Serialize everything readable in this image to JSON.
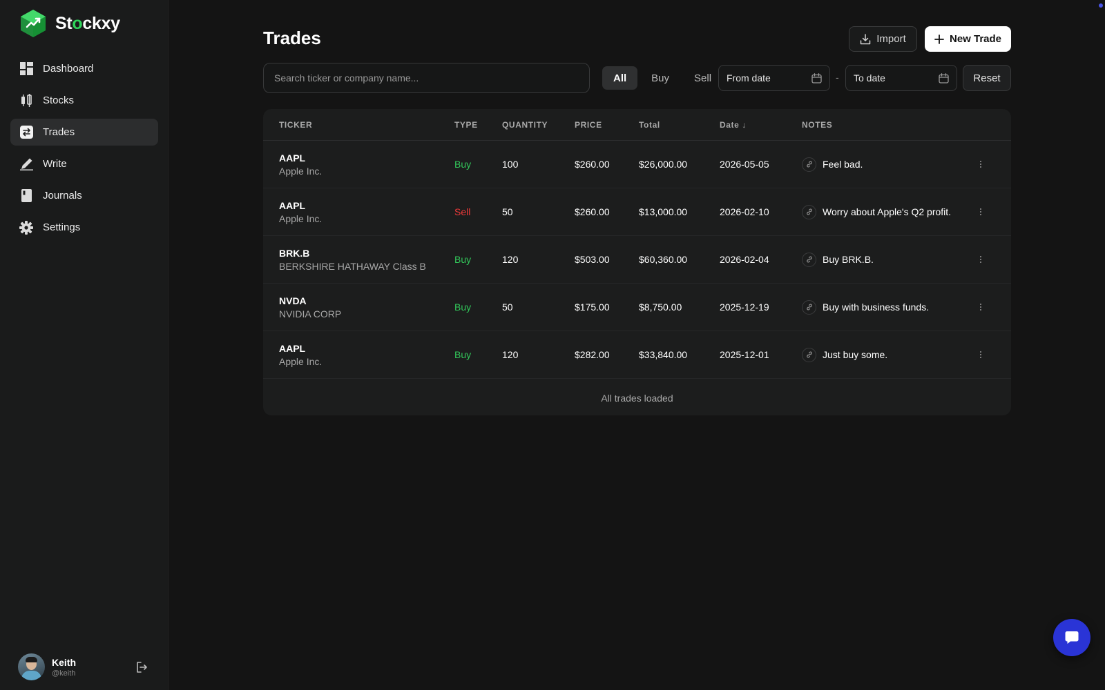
{
  "brand": {
    "name_pre": "St",
    "name_accent": "o",
    "name_post": "ckxy"
  },
  "sidebar": {
    "items": [
      {
        "label": "Dashboard",
        "icon": "dashboard-icon",
        "active": false
      },
      {
        "label": "Stocks",
        "icon": "stocks-icon",
        "active": false
      },
      {
        "label": "Trades",
        "icon": "trades-icon",
        "active": true
      },
      {
        "label": "Write",
        "icon": "pencil-icon",
        "active": false
      },
      {
        "label": "Journals",
        "icon": "book-icon",
        "active": false
      },
      {
        "label": "Settings",
        "icon": "gear-icon",
        "active": false
      }
    ]
  },
  "user": {
    "name": "Keith",
    "handle": "@keith"
  },
  "header": {
    "title": "Trades",
    "import_label": "Import",
    "new_trade_label": "New Trade"
  },
  "filters": {
    "search_placeholder": "Search ticker or company name...",
    "tabs": [
      "All",
      "Buy",
      "Sell"
    ],
    "active_tab": "All",
    "from_date": "From date",
    "to_date": "To date",
    "date_separator": "-",
    "reset_label": "Reset"
  },
  "table": {
    "columns": {
      "ticker": "TICKER",
      "type": "TYPE",
      "quantity": "QUANTITY",
      "price": "PRICE",
      "total": "Total",
      "date": "Date ↓",
      "notes": "NOTES"
    },
    "rows": [
      {
        "ticker": "AAPL",
        "company": "Apple Inc.",
        "type": "Buy",
        "quantity": "100",
        "price": "$260.00",
        "total": "$26,000.00",
        "date": "2026-05-05",
        "note": "Feel bad."
      },
      {
        "ticker": "AAPL",
        "company": "Apple Inc.",
        "type": "Sell",
        "quantity": "50",
        "price": "$260.00",
        "total": "$13,000.00",
        "date": "2026-02-10",
        "note": "Worry about Apple's Q2 profit."
      },
      {
        "ticker": "BRK.B",
        "company": "BERKSHIRE HATHAWAY Class B",
        "type": "Buy",
        "quantity": "120",
        "price": "$503.00",
        "total": "$60,360.00",
        "date": "2026-02-04",
        "note": "Buy BRK.B."
      },
      {
        "ticker": "NVDA",
        "company": "NVIDIA CORP",
        "type": "Buy",
        "quantity": "50",
        "price": "$175.00",
        "total": "$8,750.00",
        "date": "2025-12-19",
        "note": "Buy with business funds."
      },
      {
        "ticker": "AAPL",
        "company": "Apple Inc.",
        "type": "Buy",
        "quantity": "120",
        "price": "$282.00",
        "total": "$33,840.00",
        "date": "2025-12-01",
        "note": "Just buy some."
      }
    ],
    "footer": "All trades loaded"
  },
  "colors": {
    "buy": "#32c85a",
    "sell": "#ef3a3a",
    "accent": "#2fd45a",
    "chat": "#2a34d6"
  }
}
